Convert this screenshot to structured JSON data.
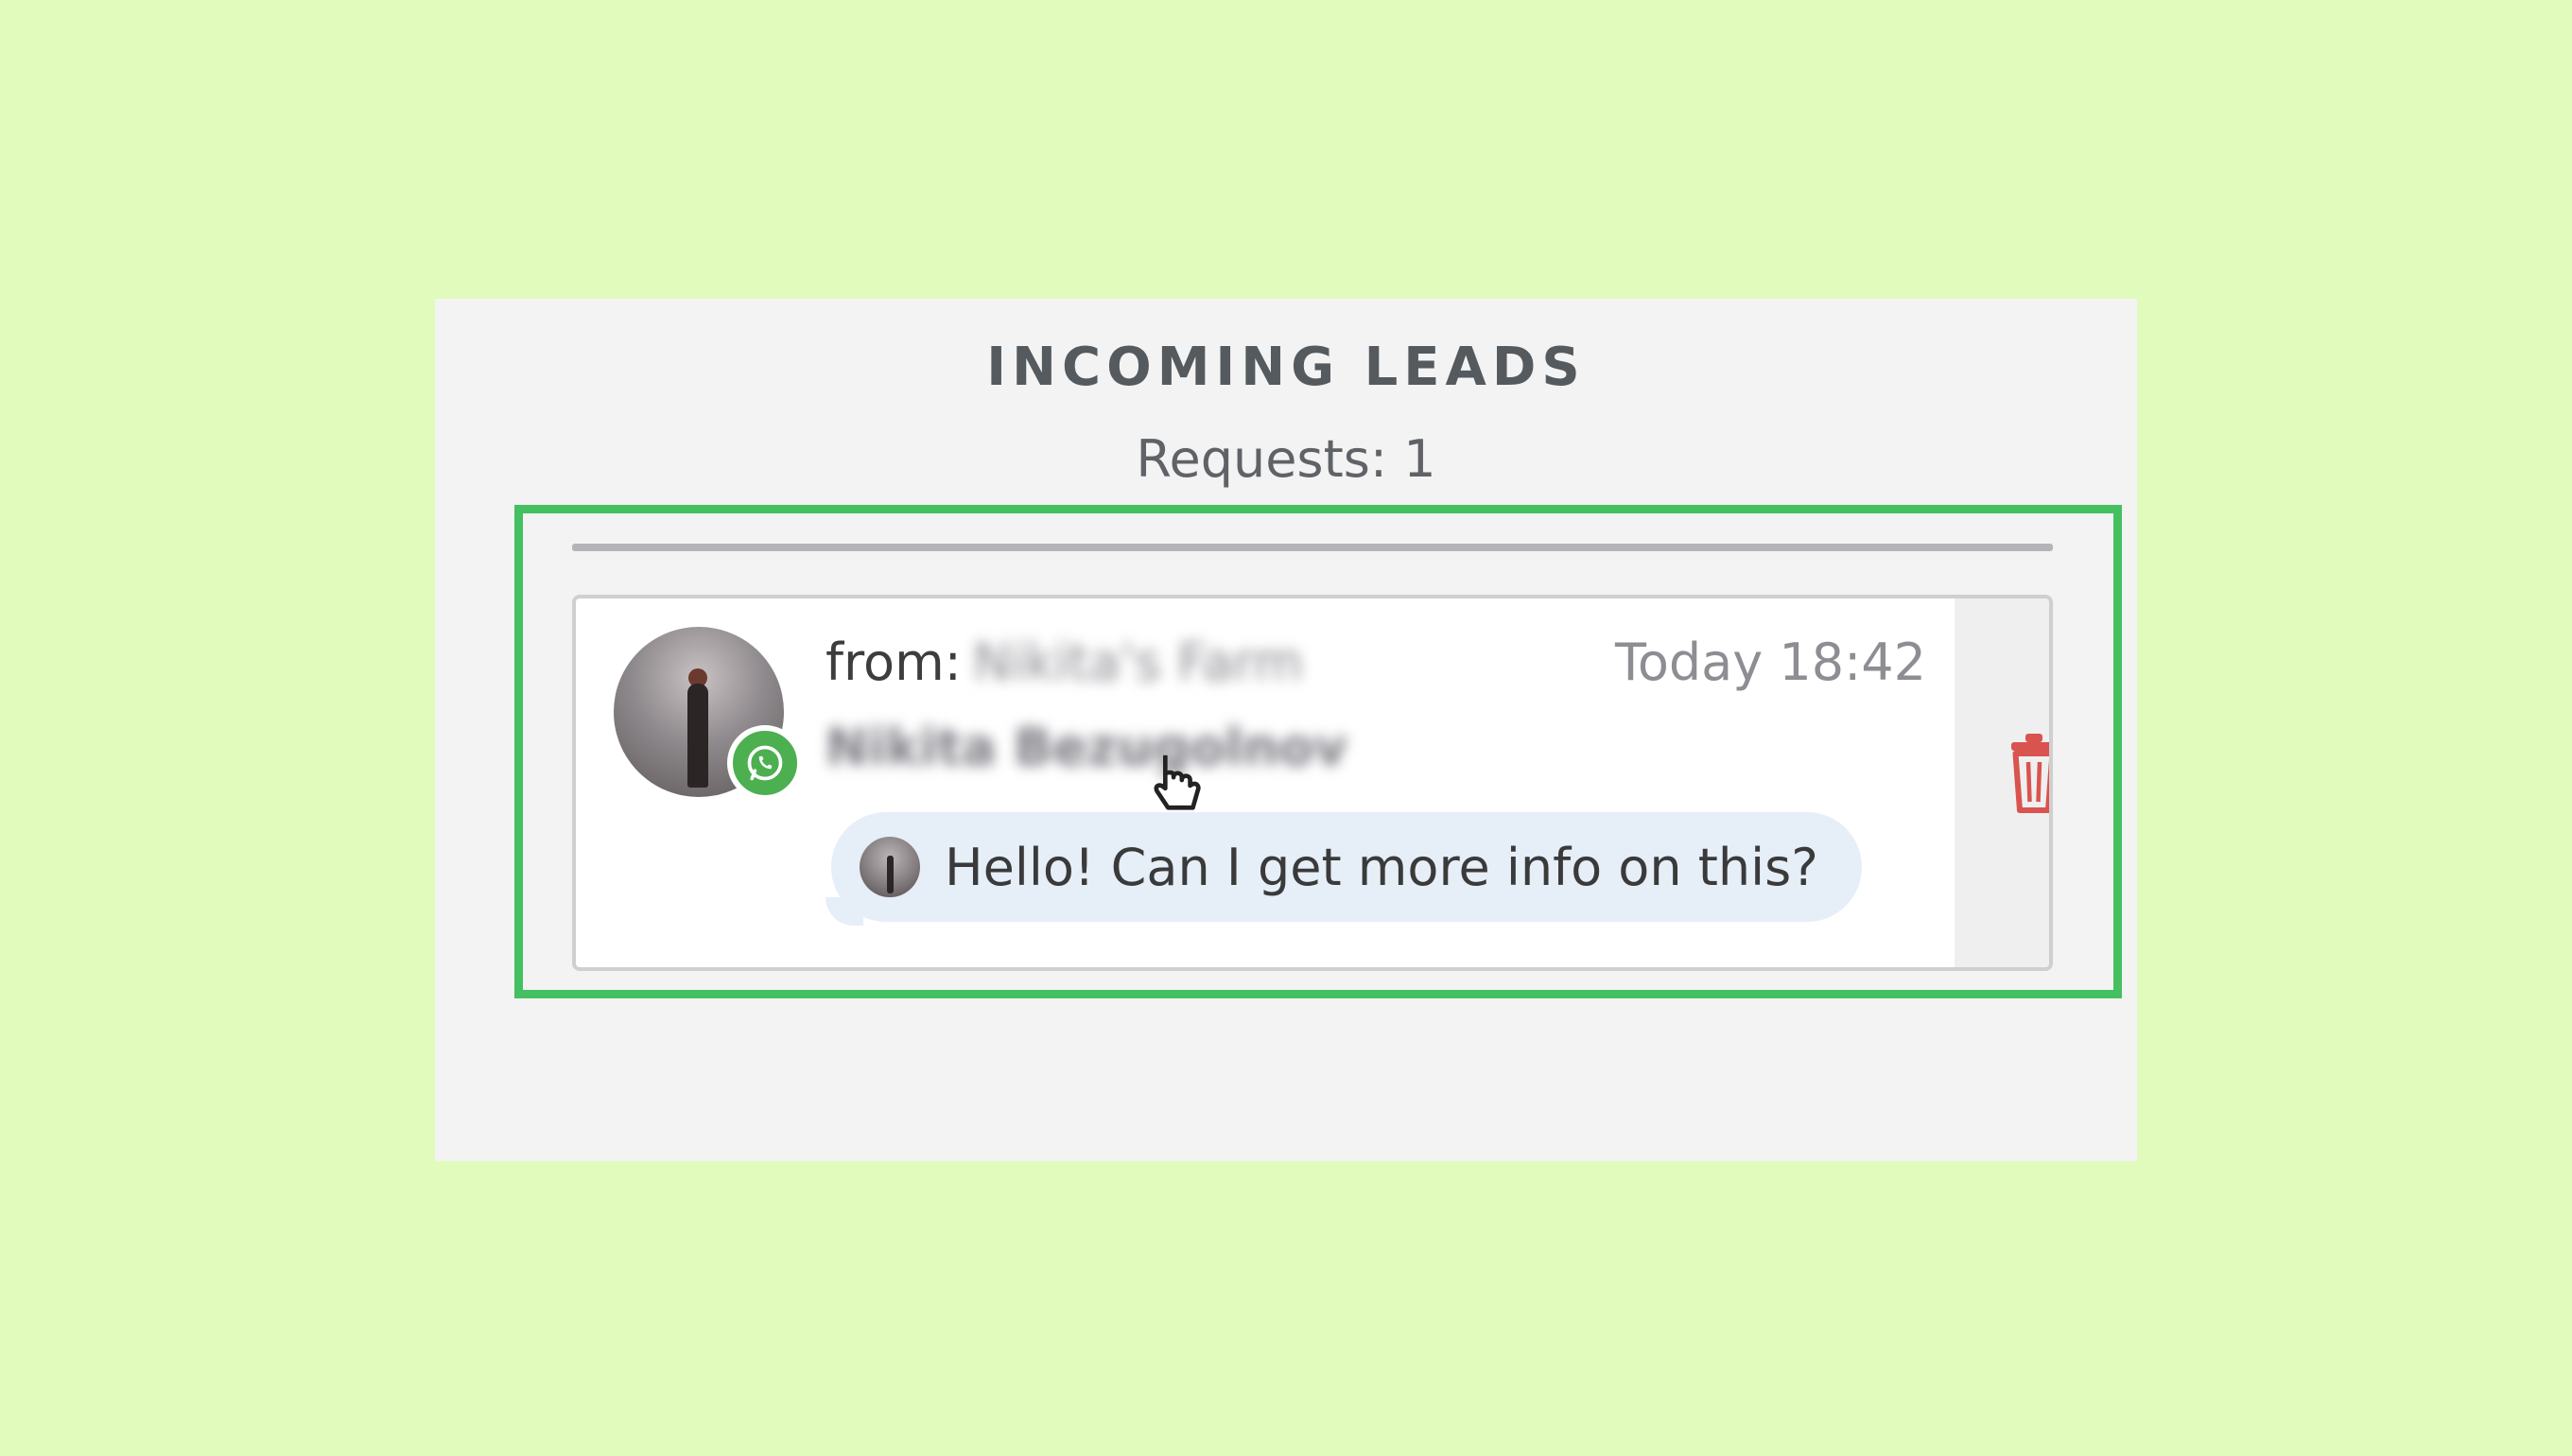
{
  "panel": {
    "title": "INCOMING LEADS",
    "subtitle": "Requests: 1"
  },
  "lead": {
    "from_label": "from:",
    "sender": "Nikita's Farm",
    "contact": "Nikita Bezugolnov",
    "timestamp": "Today 18:42",
    "message": "Hello! Can I get more info on this?",
    "channel_icon": "whatsapp-icon",
    "action_icon": "trash-icon"
  },
  "colors": {
    "background": "#e1fbbd",
    "highlight": "#44c060",
    "channel": "#4caf50",
    "delete": "#d9534f",
    "bubble": "#e6eef8"
  }
}
